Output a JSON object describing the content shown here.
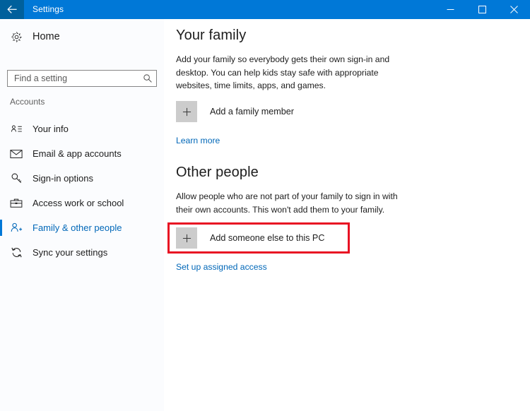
{
  "window": {
    "title": "Settings",
    "back_icon": "back-arrow-icon",
    "controls": [
      {
        "name": "minimize",
        "icon": "minimize-icon"
      },
      {
        "name": "maximize",
        "icon": "maximize-icon"
      },
      {
        "name": "close",
        "icon": "close-icon"
      }
    ],
    "accent_color": "#0078d7",
    "back_button_color": "#00609c"
  },
  "sidebar": {
    "home": {
      "label": "Home",
      "icon": "gear-icon"
    },
    "search": {
      "placeholder": "Find a setting",
      "value": "",
      "icon": "search-icon"
    },
    "category": "Accounts",
    "items": [
      {
        "label": "Your info",
        "icon": "user-info-icon",
        "selected": false
      },
      {
        "label": "Email & app accounts",
        "icon": "envelope-icon",
        "selected": false
      },
      {
        "label": "Sign-in options",
        "icon": "key-icon",
        "selected": false
      },
      {
        "label": "Access work or school",
        "icon": "briefcase-icon",
        "selected": false
      },
      {
        "label": "Family & other people",
        "icon": "person-add-icon",
        "selected": true
      },
      {
        "label": "Sync your settings",
        "icon": "sync-icon",
        "selected": false
      }
    ],
    "selected_color": "#0067b8"
  },
  "main": {
    "family": {
      "title": "Your family",
      "description": "Add your family so everybody gets their own sign-in and desktop. You can help kids stay safe with appropriate websites, time limits, apps, and games.",
      "add_button": {
        "label": "Add a family member",
        "icon": "plus-icon"
      },
      "link": "Learn more"
    },
    "other_people": {
      "title": "Other people",
      "description": "Allow people who are not part of your family to sign in with their own accounts. This won't add them to your family.",
      "add_button": {
        "label": "Add someone else to this PC",
        "icon": "plus-icon"
      },
      "link": "Set up assigned access"
    },
    "highlight": {
      "color": "#e81123",
      "target": "add-someone-else-button"
    }
  }
}
